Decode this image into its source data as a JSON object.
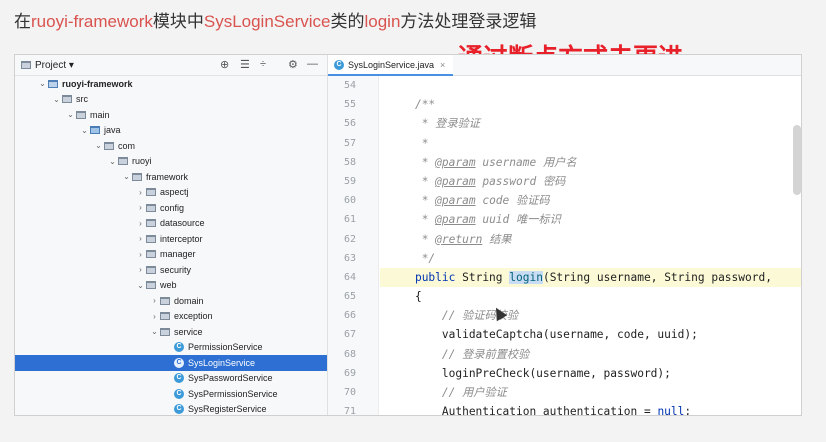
{
  "caption": {
    "part1": "在",
    "module": "ruoyi-framework",
    "part2": "模块中",
    "service": "SysLoginService",
    "part3": "类的",
    "method": "login",
    "part4": "方法处理登录逻辑"
  },
  "annotation": "通过断点方式去更进",
  "project_panel": {
    "title": "Project ▾",
    "tree": [
      {
        "label": "ruoyi-framework",
        "depth": 1,
        "arrow": "⌄",
        "kind": "mod",
        "bold": true
      },
      {
        "label": "src",
        "depth": 2,
        "arrow": "⌄",
        "kind": "folder"
      },
      {
        "label": "main",
        "depth": 3,
        "arrow": "⌄",
        "kind": "folder"
      },
      {
        "label": "java",
        "depth": 4,
        "arrow": "⌄",
        "kind": "src"
      },
      {
        "label": "com",
        "depth": 5,
        "arrow": "⌄",
        "kind": "folder"
      },
      {
        "label": "ruoyi",
        "depth": 6,
        "arrow": "⌄",
        "kind": "folder"
      },
      {
        "label": "framework",
        "depth": 7,
        "arrow": "⌄",
        "kind": "folder"
      },
      {
        "label": "aspectj",
        "depth": 8,
        "arrow": "›",
        "kind": "folder"
      },
      {
        "label": "config",
        "depth": 8,
        "arrow": "›",
        "kind": "folder"
      },
      {
        "label": "datasource",
        "depth": 8,
        "arrow": "›",
        "kind": "folder"
      },
      {
        "label": "interceptor",
        "depth": 8,
        "arrow": "›",
        "kind": "folder"
      },
      {
        "label": "manager",
        "depth": 8,
        "arrow": "›",
        "kind": "folder"
      },
      {
        "label": "security",
        "depth": 8,
        "arrow": "›",
        "kind": "folder"
      },
      {
        "label": "web",
        "depth": 8,
        "arrow": "⌄",
        "kind": "folder"
      },
      {
        "label": "domain",
        "depth": 9,
        "arrow": "›",
        "kind": "folder"
      },
      {
        "label": "exception",
        "depth": 9,
        "arrow": "›",
        "kind": "folder"
      },
      {
        "label": "service",
        "depth": 9,
        "arrow": "⌄",
        "kind": "folder"
      },
      {
        "label": "PermissionService",
        "depth": 10,
        "arrow": "",
        "kind": "class"
      },
      {
        "label": "SysLoginService",
        "depth": 10,
        "arrow": "",
        "kind": "class",
        "selected": true
      },
      {
        "label": "SysPasswordService",
        "depth": 10,
        "arrow": "",
        "kind": "class"
      },
      {
        "label": "SysPermissionService",
        "depth": 10,
        "arrow": "",
        "kind": "class"
      },
      {
        "label": "SysRegisterService",
        "depth": 10,
        "arrow": "",
        "kind": "class"
      }
    ]
  },
  "editor": {
    "tab_label": "SysLoginService.java",
    "tab_close": "×",
    "lines": [
      {
        "n": "54",
        "html": ""
      },
      {
        "n": "55",
        "html": "    <span class='cm'>/**</span>"
      },
      {
        "n": "56",
        "html": "    <span class='cm'> * 登录验证</span>"
      },
      {
        "n": "57",
        "html": "    <span class='cm'> *</span>"
      },
      {
        "n": "58",
        "html": "    <span class='cm'> * <span class='tag'>@param</span> username 用户名</span>"
      },
      {
        "n": "59",
        "html": "    <span class='cm'> * <span class='tag'>@param</span> password 密码</span>"
      },
      {
        "n": "60",
        "html": "    <span class='cm'> * <span class='tag'>@param</span> code 验证码</span>"
      },
      {
        "n": "61",
        "html": "    <span class='cm'> * <span class='tag'>@param</span> uuid 唯一标识</span>"
      },
      {
        "n": "62",
        "html": "    <span class='cm'> * <span class='tag'>@return</span> 结果</span>"
      },
      {
        "n": "63",
        "html": "    <span class='cm'> */</span>"
      },
      {
        "n": "64",
        "html": "    <span class='kw'>public</span> String <span class='fnsel'>login</span>(String username, String password,",
        "cur": true
      },
      {
        "n": "65",
        "html": "    {"
      },
      {
        "n": "66",
        "html": "        <span class='cm'>// 验证码校验</span>"
      },
      {
        "n": "67",
        "html": "        validateCaptcha(username, code, uuid);"
      },
      {
        "n": "68",
        "html": "        <span class='cm'>// 登录前置校验</span>"
      },
      {
        "n": "69",
        "html": "        loginPreCheck(username, password);"
      },
      {
        "n": "70",
        "html": "        <span class='cm'>// 用户验证</span>"
      },
      {
        "n": "71",
        "html": "        Authentication <span class='underl'>authentication</span> = <span class='kw'>null</span>;"
      }
    ]
  }
}
